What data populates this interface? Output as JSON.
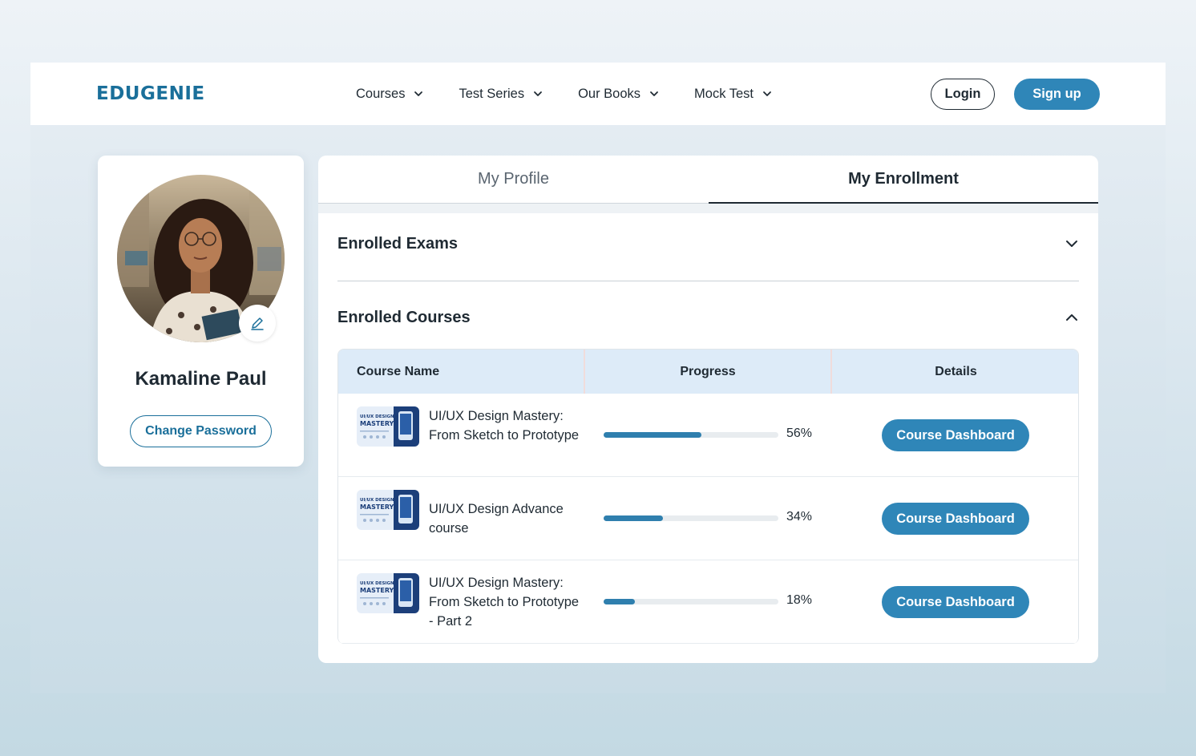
{
  "brand": {
    "logo_text": "EDUGENIE",
    "accent_color": "#2f86b8",
    "brand_color": "#1a6f9a"
  },
  "nav": {
    "items": [
      {
        "label": "Courses",
        "icon": "chevron-down-icon"
      },
      {
        "label": "Test Series",
        "icon": "chevron-down-icon"
      },
      {
        "label": "Our Books",
        "icon": "chevron-down-icon"
      },
      {
        "label": "Mock Test",
        "icon": "chevron-down-icon"
      }
    ],
    "login_label": "Login",
    "signup_label": "Sign up"
  },
  "profile": {
    "name": "Kamaline Paul",
    "avatar_icon": "user-photo",
    "edit_icon": "pencil-icon",
    "change_password_label": "Change Password"
  },
  "tabs": [
    {
      "label": "My Profile",
      "active": false
    },
    {
      "label": "My Enrollment",
      "active": true
    }
  ],
  "sections": {
    "exams": {
      "title": "Enrolled Exams",
      "expanded": false,
      "icon": "chevron-down-icon"
    },
    "courses": {
      "title": "Enrolled Courses",
      "expanded": true,
      "icon": "chevron-up-icon"
    }
  },
  "table": {
    "headers": [
      "Course Name",
      "Progress",
      "Details"
    ],
    "thumb_text": {
      "line1": "UI/UX DESIGN",
      "line2": "MASTERY"
    },
    "rows": [
      {
        "name": "UI/UX Design Mastery: From Sketch to Prototype",
        "progress": 0.56,
        "progress_label": "56%",
        "action_label": "Course Dashboard"
      },
      {
        "name": "UI/UX Design Advance course",
        "progress": 0.34,
        "progress_label": "34%",
        "action_label": "Course Dashboard"
      },
      {
        "name": "UI/UX Design Mastery: From Sketch to Prototype - Part 2",
        "progress": 0.18,
        "progress_label": "18%",
        "action_label": "Course Dashboard"
      }
    ]
  }
}
